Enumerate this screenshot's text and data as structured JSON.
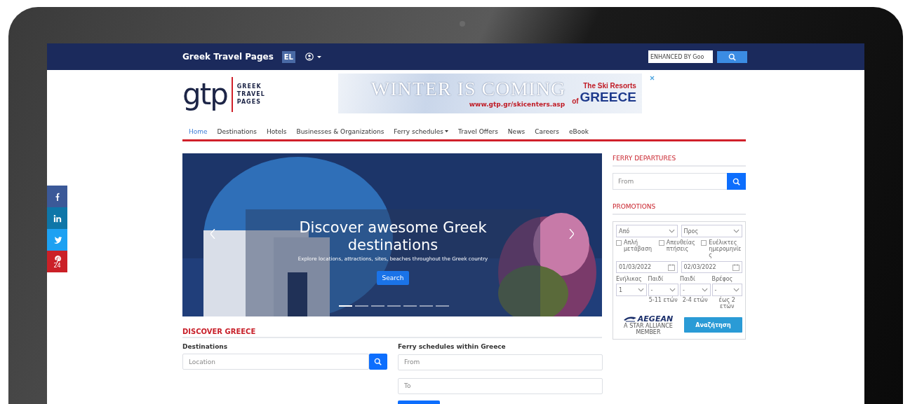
{
  "topbar": {
    "site_name": "Greek Travel Pages",
    "language": "EL",
    "search_placeholder": "ENHANCED BY Goo"
  },
  "header": {
    "logo_mark": "gtp",
    "logo_words": [
      "GREEK",
      "TRAVEL",
      "PAGES"
    ],
    "ad": {
      "headline": "WINTER IS COMING",
      "url": "www.gtp.gr/skicenters.asp",
      "tagline": "The Ski Resorts",
      "tagline_prefix": "of",
      "tagline_main": "GREECE"
    }
  },
  "nav": {
    "items": [
      {
        "label": "Home",
        "kind": "link",
        "selected": true
      },
      {
        "label": "Destinations",
        "kind": "link",
        "selected": false
      },
      {
        "label": "Hotels",
        "kind": "link",
        "selected": false
      },
      {
        "label": "Businesses & Organizations",
        "kind": "link",
        "selected": false
      },
      {
        "label": "Ferry schedules",
        "kind": "dropdown",
        "selected": false
      },
      {
        "label": "Travel Offers",
        "kind": "link",
        "selected": false
      },
      {
        "label": "News",
        "kind": "link",
        "selected": false
      },
      {
        "label": "Careers",
        "kind": "link",
        "selected": false
      },
      {
        "label": "eBook",
        "kind": "link",
        "selected": false
      }
    ]
  },
  "hero": {
    "title": "Discover awesome Greek destinations",
    "subtitle": "Explore locations, attractions, sites, beaches throughout the Greek country",
    "button": "Search",
    "indicators": [
      {
        "selected": true
      },
      {
        "selected": false
      },
      {
        "selected": false
      },
      {
        "selected": false
      },
      {
        "selected": false
      },
      {
        "selected": false
      },
      {
        "selected": false
      }
    ]
  },
  "discover": {
    "heading": "DISCOVER GREECE",
    "destinations": {
      "label": "Destinations",
      "placeholder": "Location"
    },
    "ferry": {
      "label": "Ferry schedules within Greece",
      "from_placeholder": "From",
      "to_placeholder": "To"
    }
  },
  "sidebar": {
    "ferry_departures": {
      "heading": "FERRY DEPARTURES",
      "placeholder": "From"
    },
    "promotions": {
      "heading": "PROMOTIONS",
      "widget": {
        "from_placeholder": "Από",
        "to_placeholder": "Προς",
        "options": [
          {
            "label": "Απλή μετάβαση",
            "checked": false
          },
          {
            "label": "Απευθείας πτήσεις",
            "checked": false
          },
          {
            "label": "Ευέλικτες ημερομηνίες",
            "checked": false
          }
        ],
        "dates": [
          "01/03/2022",
          "02/03/2022"
        ],
        "passengers": [
          {
            "label": "Ενήλικας",
            "value": "1"
          },
          {
            "label": "Παιδί",
            "value": "-",
            "note": "5-11 ετών"
          },
          {
            "label": "Παιδί",
            "value": "-",
            "note": "2-4 ετών"
          },
          {
            "label": "Βρέφος",
            "value": "-",
            "note": "έως 2 ετών"
          }
        ],
        "brand": "AEGEAN",
        "brand_tagline": "A STAR ALLIANCE MEMBER",
        "search_button": "Αναζήτηση"
      }
    }
  },
  "social": [
    {
      "kind": "facebook",
      "color": "#3b5998"
    },
    {
      "kind": "linkedin",
      "color": "#0e76a8"
    },
    {
      "kind": "twitter",
      "color": "#1da1f2"
    },
    {
      "kind": "pinterest",
      "color": "#cb2027",
      "count": "24"
    }
  ]
}
